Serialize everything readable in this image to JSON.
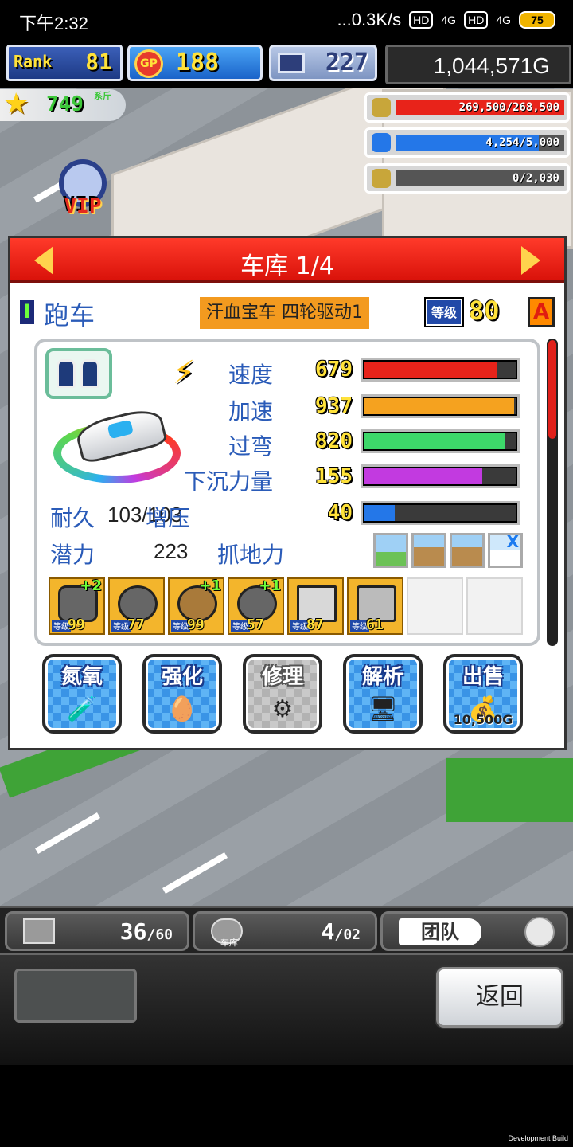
{
  "status_bar": {
    "time": "下午2:32",
    "net_speed": "...0.3K/s",
    "hd1": "HD",
    "net1": "4G",
    "hd2": "HD",
    "net2": "4G",
    "battery": "75"
  },
  "hud": {
    "rank_label": "Rank",
    "rank_value": "81",
    "gp_label": "GP",
    "gp_value": "188",
    "pc_value": "227",
    "money": "1,044,571G",
    "star_value": "749",
    "star_tag": "系斤",
    "vip_label": "VIP",
    "resources": [
      {
        "name": "coins",
        "text": "269,500/268,500",
        "fill": 1.0,
        "color": "#e8231a"
      },
      {
        "name": "fuel",
        "text": "4,254/5,000",
        "fill": 0.85,
        "color": "#2477e8"
      },
      {
        "name": "wheat",
        "text": "0/2,030",
        "fill": 0.0,
        "color": "#3dc83a"
      }
    ]
  },
  "panel": {
    "title": "车库 1/4",
    "class_badge": "I",
    "class_name": "跑车",
    "car_name": "汗血宝车 四轮驱动1",
    "level_label": "等级",
    "level_value": "80",
    "grade": "A",
    "stats": [
      {
        "label": "速度",
        "value": "679",
        "fill": 0.88,
        "color": "#e8231a"
      },
      {
        "label": "加速",
        "value": "937",
        "fill": 0.99,
        "color": "#f5a21f"
      },
      {
        "label": "过弯",
        "value": "820",
        "fill": 0.93,
        "color": "#3dd86a"
      },
      {
        "label": "下沉力量",
        "value": "155",
        "fill": 0.78,
        "color": "#c23ae0"
      },
      {
        "label": "增压",
        "value": "40",
        "fill": 0.2,
        "color": "#2477e8"
      }
    ],
    "durability_label": "耐久",
    "durability_value": "103/103",
    "potential_label": "潜力",
    "potential_value": "223",
    "grip_label": "抓地力",
    "grip_x": "X",
    "parts": [
      {
        "level": "99",
        "plus": "+2"
      },
      {
        "level": "77",
        "plus": ""
      },
      {
        "level": "99",
        "plus": "+1"
      },
      {
        "level": "57",
        "plus": "+1"
      },
      {
        "level": "87",
        "plus": ""
      },
      {
        "level": "61",
        "plus": ""
      }
    ],
    "part_level_tag": "等级",
    "actions": [
      {
        "label": "氮氧",
        "price": ""
      },
      {
        "label": "强化",
        "price": ""
      },
      {
        "label": "修理",
        "price": ""
      },
      {
        "label": "解析",
        "price": ""
      },
      {
        "label": "出售",
        "price": "10,500G"
      }
    ]
  },
  "bottom": {
    "tab1_count": "36",
    "tab1_max": "/60",
    "tab2_count": "4",
    "tab2_max": "/02",
    "tab2_sub": "车库",
    "team_label": "团队",
    "back_label": "返回"
  },
  "dev_build": "Development Build"
}
